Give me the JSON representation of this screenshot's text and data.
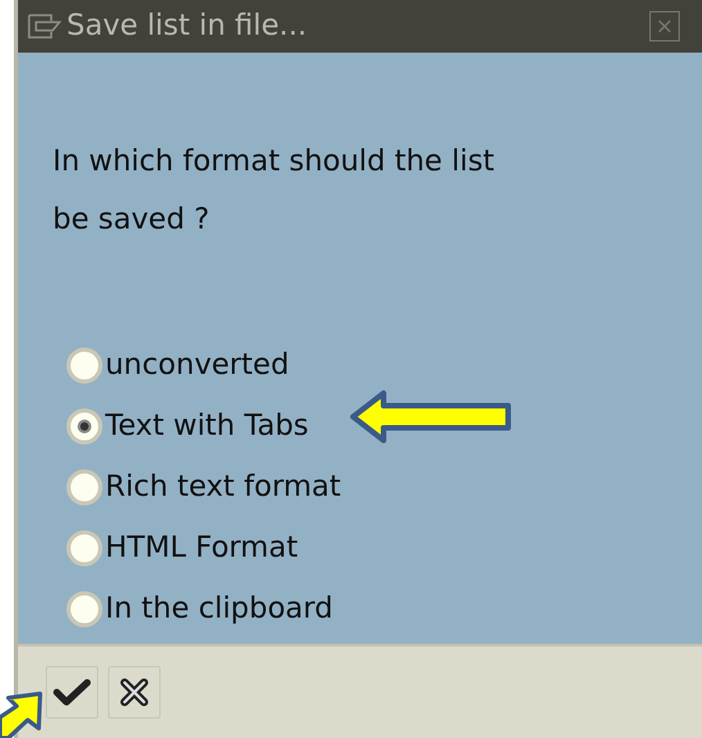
{
  "window": {
    "title": "Save list in file..."
  },
  "question": "In which format should the list be saved ?",
  "options": [
    {
      "label": "unconverted",
      "selected": false
    },
    {
      "label": "Text with Tabs",
      "selected": true
    },
    {
      "label": "Rich text format",
      "selected": false
    },
    {
      "label": "HTML Format",
      "selected": false
    },
    {
      "label": "In the clipboard",
      "selected": false
    }
  ]
}
